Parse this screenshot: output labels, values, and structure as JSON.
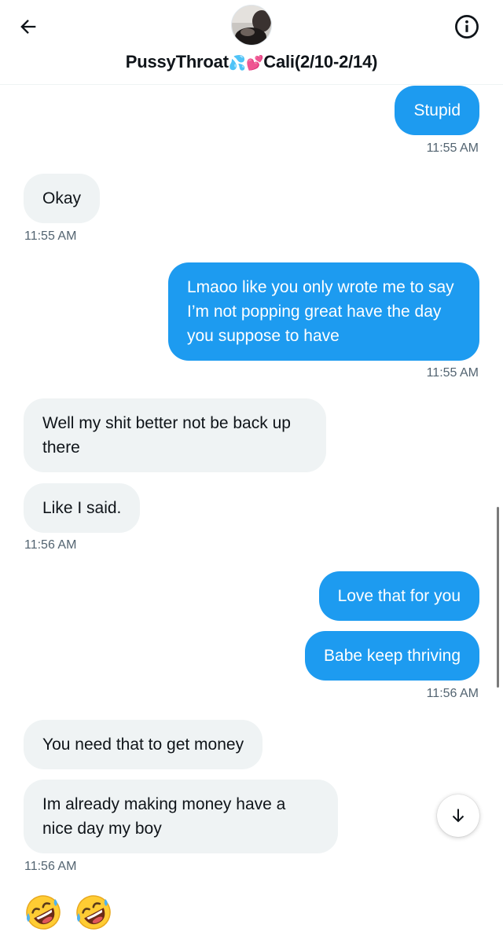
{
  "header": {
    "back_icon": "arrow-left-icon",
    "info_icon": "info-icon",
    "title_name": "PussyThroat",
    "title_emoji": "💦💕",
    "title_suffix": "Cali(2/10-2/14)"
  },
  "messages": [
    {
      "direction": "out",
      "text": "Stupid",
      "time": "11:55 AM"
    },
    {
      "direction": "in",
      "text": "Okay",
      "time": "11:55 AM"
    },
    {
      "direction": "out",
      "text": "Lmaoo like you only wrote me to say I’m not popping great have the day you suppose to have",
      "time": "11:55 AM"
    },
    {
      "direction": "in",
      "text": "Well my shit better not be back up there",
      "time": ""
    },
    {
      "direction": "in",
      "text": "Like I said.",
      "time": "11:56 AM"
    },
    {
      "direction": "out",
      "text": "Love that for you",
      "time": ""
    },
    {
      "direction": "out",
      "text": "Babe keep thriving",
      "time": "11:56 AM"
    },
    {
      "direction": "in",
      "text": "You need that to get money",
      "time": ""
    },
    {
      "direction": "in",
      "text": "Im already making money have a nice day my boy",
      "time": "11:56 AM"
    }
  ],
  "reactions": [
    "rolling-on-the-floor-laughing",
    "rolling-on-the-floor-laughing"
  ],
  "scroll_button_icon": "arrow-down-icon",
  "colors": {
    "outgoing": "#1d9bf0",
    "incoming": "#eff3f4",
    "timestamp": "#536471"
  }
}
